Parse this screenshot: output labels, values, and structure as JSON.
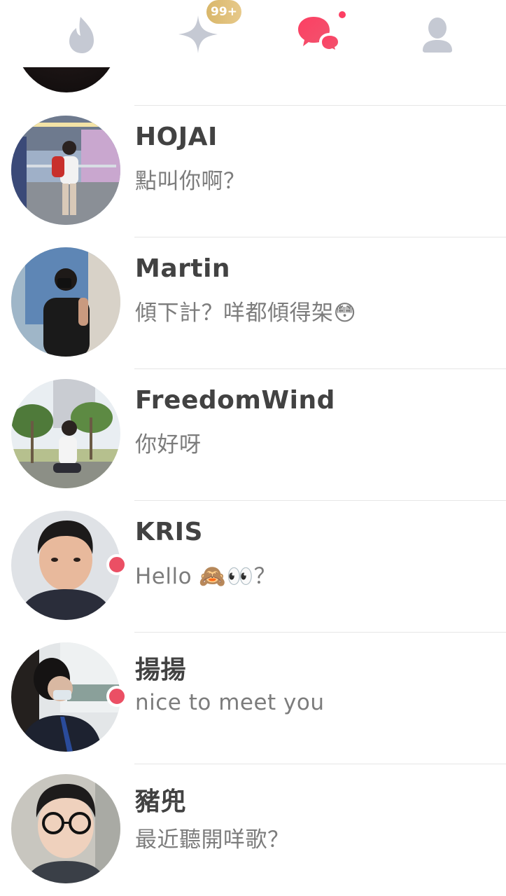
{
  "tabs": [
    {
      "name": "flame",
      "icon": "flame-icon",
      "active": false
    },
    {
      "name": "explore",
      "icon": "sparkle-icon",
      "active": false,
      "badge": "99+"
    },
    {
      "name": "messages",
      "icon": "chat-bubbles-icon",
      "active": true,
      "has_notification": true
    },
    {
      "name": "profile",
      "icon": "person-icon",
      "active": false
    }
  ],
  "colors": {
    "accent": "#fd3f63",
    "inactive_icon": "#c5c9d3",
    "badge_gold": "#dfc07b",
    "unread_dot": "#eb4f64",
    "name_text": "#424242",
    "preview_text": "#7c7c7c"
  },
  "conversations": [
    {
      "name": "HOJAI",
      "preview": "點叫你啊？",
      "unread": false
    },
    {
      "name": "Martin",
      "preview": "傾下計？咩都傾得架😳",
      "unread": false
    },
    {
      "name": "FreedomWind",
      "preview": "你好呀",
      "unread": false
    },
    {
      "name": "KRIS",
      "preview": "Hello 🙈👀？",
      "unread": true
    },
    {
      "name": "揚揚",
      "preview": "nice to meet you",
      "unread": true
    },
    {
      "name": "豬兜",
      "preview": "最近聽開咩歌？",
      "unread": false
    }
  ]
}
